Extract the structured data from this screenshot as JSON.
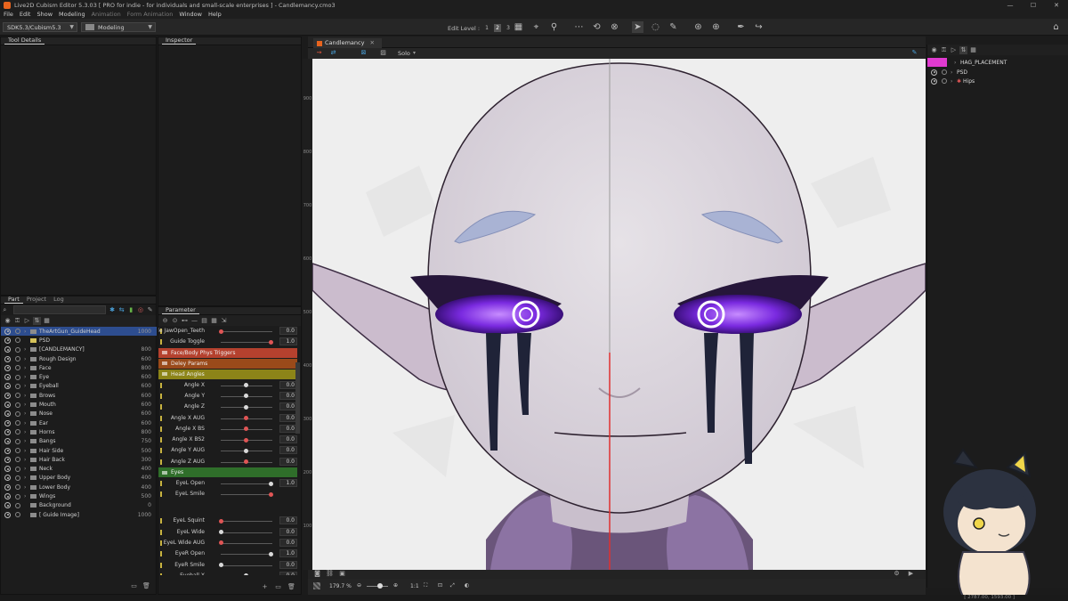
{
  "window": {
    "title": "Live2D Cubism Editor 5.3.03    [ PRO for indie - for individuals and small-scale enterprises ]  - Candlemancy.cmo3",
    "minimize": "—",
    "maximize": "☐",
    "close": "✕"
  },
  "menu": {
    "items": [
      "File",
      "Edit",
      "Show",
      "Modeling",
      "Animation",
      "Form Animation",
      "Window",
      "Help"
    ]
  },
  "toolbar": {
    "sdk_combo": "SDK5.3/Cubism5.3",
    "mode_combo": "Modeling",
    "edit_level_label": "Edit Level :",
    "edit_levels": [
      "1",
      "2",
      "3"
    ]
  },
  "tool_details": {
    "tab": "Tool Details"
  },
  "inspector": {
    "tab": "Inspector"
  },
  "bottom_left_tabs": {
    "part": "Part",
    "project": "Project",
    "log": "Log"
  },
  "parts": [
    {
      "name": "TheArtGun_GuideHead",
      "value": "1000",
      "psd": false,
      "selected": true
    },
    {
      "name": "PSD",
      "value": "",
      "psd": true,
      "selected": false
    },
    {
      "name": "[CANDLEMANCY]",
      "value": "800",
      "psd": false,
      "selected": false
    },
    {
      "name": "Rough Design",
      "value": "600",
      "psd": false,
      "selected": false
    },
    {
      "name": "Face",
      "value": "800",
      "psd": false,
      "selected": false
    },
    {
      "name": "Eye",
      "value": "600",
      "psd": false,
      "selected": false
    },
    {
      "name": "Eyeball",
      "value": "600",
      "psd": false,
      "selected": false
    },
    {
      "name": "Brows",
      "value": "600",
      "psd": false,
      "selected": false
    },
    {
      "name": "Mouth",
      "value": "600",
      "psd": false,
      "selected": false
    },
    {
      "name": "Nose",
      "value": "600",
      "psd": false,
      "selected": false
    },
    {
      "name": "Ear",
      "value": "600",
      "psd": false,
      "selected": false
    },
    {
      "name": "Horns",
      "value": "800",
      "psd": false,
      "selected": false
    },
    {
      "name": "Bangs",
      "value": "750",
      "psd": false,
      "selected": false
    },
    {
      "name": "Hair Side",
      "value": "500",
      "psd": false,
      "selected": false
    },
    {
      "name": "Hair Back",
      "value": "300",
      "psd": false,
      "selected": false
    },
    {
      "name": "Neck",
      "value": "400",
      "psd": false,
      "selected": false
    },
    {
      "name": "Upper Body",
      "value": "400",
      "psd": false,
      "selected": false
    },
    {
      "name": "Lower Body",
      "value": "400",
      "psd": false,
      "selected": false
    },
    {
      "name": "Wings",
      "value": "500",
      "psd": false,
      "selected": false
    },
    {
      "name": "Background",
      "value": "0",
      "psd": false,
      "selected": false
    },
    {
      "name": "[ Guide Image]",
      "value": "1000",
      "psd": false,
      "selected": false
    }
  ],
  "parameter_panel": {
    "tab": "Parameter",
    "rows": [
      {
        "kind": "param",
        "name": "Guide JawOpen_Teeth",
        "value": "0.0",
        "knob": 0.0,
        "red": true
      },
      {
        "kind": "param",
        "name": "Guide Toggle",
        "value": "1.0",
        "knob": 1.0,
        "red": true
      },
      {
        "kind": "group",
        "name": "Face/Body Phys Triggers",
        "color": "#b5412e"
      },
      {
        "kind": "group",
        "name": "Deley Params",
        "color": "#9a4a1a"
      },
      {
        "kind": "group",
        "name": "Head Angles",
        "color": "#8c8418"
      },
      {
        "kind": "param",
        "name": "Angle X",
        "value": "0.0",
        "knob": 0.5,
        "red": false
      },
      {
        "kind": "param",
        "name": "Angle Y",
        "value": "0.0",
        "knob": 0.5,
        "red": false
      },
      {
        "kind": "param",
        "name": "Angle Z",
        "value": "0.0",
        "knob": 0.5,
        "red": false
      },
      {
        "kind": "param",
        "name": "Angle X AUG",
        "value": "0.0",
        "knob": 0.5,
        "red": true
      },
      {
        "kind": "param",
        "name": "Angle X BS",
        "value": "0.0",
        "knob": 0.5,
        "red": true
      },
      {
        "kind": "param",
        "name": "Angle X BS2",
        "value": "0.0",
        "knob": 0.5,
        "red": true
      },
      {
        "kind": "param",
        "name": "Angle Y AUG",
        "value": "0.0",
        "knob": 0.5,
        "red": false
      },
      {
        "kind": "param",
        "name": "Angle Z AUG",
        "value": "0.0",
        "knob": 0.5,
        "red": true
      },
      {
        "kind": "group",
        "name": "Eyes",
        "color": "#2f6e2a"
      },
      {
        "kind": "param",
        "name": "EyeL Open",
        "value": "1.0",
        "knob": 1.0,
        "red": false
      },
      {
        "kind": "param",
        "name": "EyeL Smile",
        "value": "",
        "knob": 1.0,
        "red": true
      },
      {
        "kind": "param",
        "name": "EyeL Squint",
        "value": "0.0",
        "knob": 0.0,
        "red": true
      },
      {
        "kind": "param",
        "name": "EyeL Wide",
        "value": "0.0",
        "knob": 0.0,
        "red": false
      },
      {
        "kind": "param",
        "name": "EyeL Wide AUG",
        "value": "0.0",
        "knob": 0.0,
        "red": true
      },
      {
        "kind": "param",
        "name": "EyeR Open",
        "value": "1.0",
        "knob": 1.0,
        "red": false
      },
      {
        "kind": "param",
        "name": "EyeR Smile",
        "value": "0.0",
        "knob": 0.0,
        "red": false
      },
      {
        "kind": "param",
        "name": "Eyeball X",
        "value": "0.0",
        "knob": 0.5,
        "red": false
      }
    ]
  },
  "viewport": {
    "tab": "Candlemancy",
    "solo": "Solo",
    "ruler": [
      "900",
      "800",
      "700",
      "600",
      "500",
      "400",
      "300",
      "200",
      "100"
    ],
    "zoom": "179.7 %",
    "one_to_one": "1:1",
    "coords": "[ 2787.00, 1593.00 ]"
  },
  "right_panel": {
    "rows": [
      {
        "name": "HAG_PLACEMENT",
        "highlight": true
      },
      {
        "name": "PSD",
        "highlight": false
      },
      {
        "name": "Hips",
        "highlight": false
      }
    ]
  },
  "colors": {
    "accent_orange": "#e8641e",
    "selection_blue": "#2d4d8f",
    "magenta": "#e03ad0",
    "eye_purple": "#7a2ae0"
  }
}
